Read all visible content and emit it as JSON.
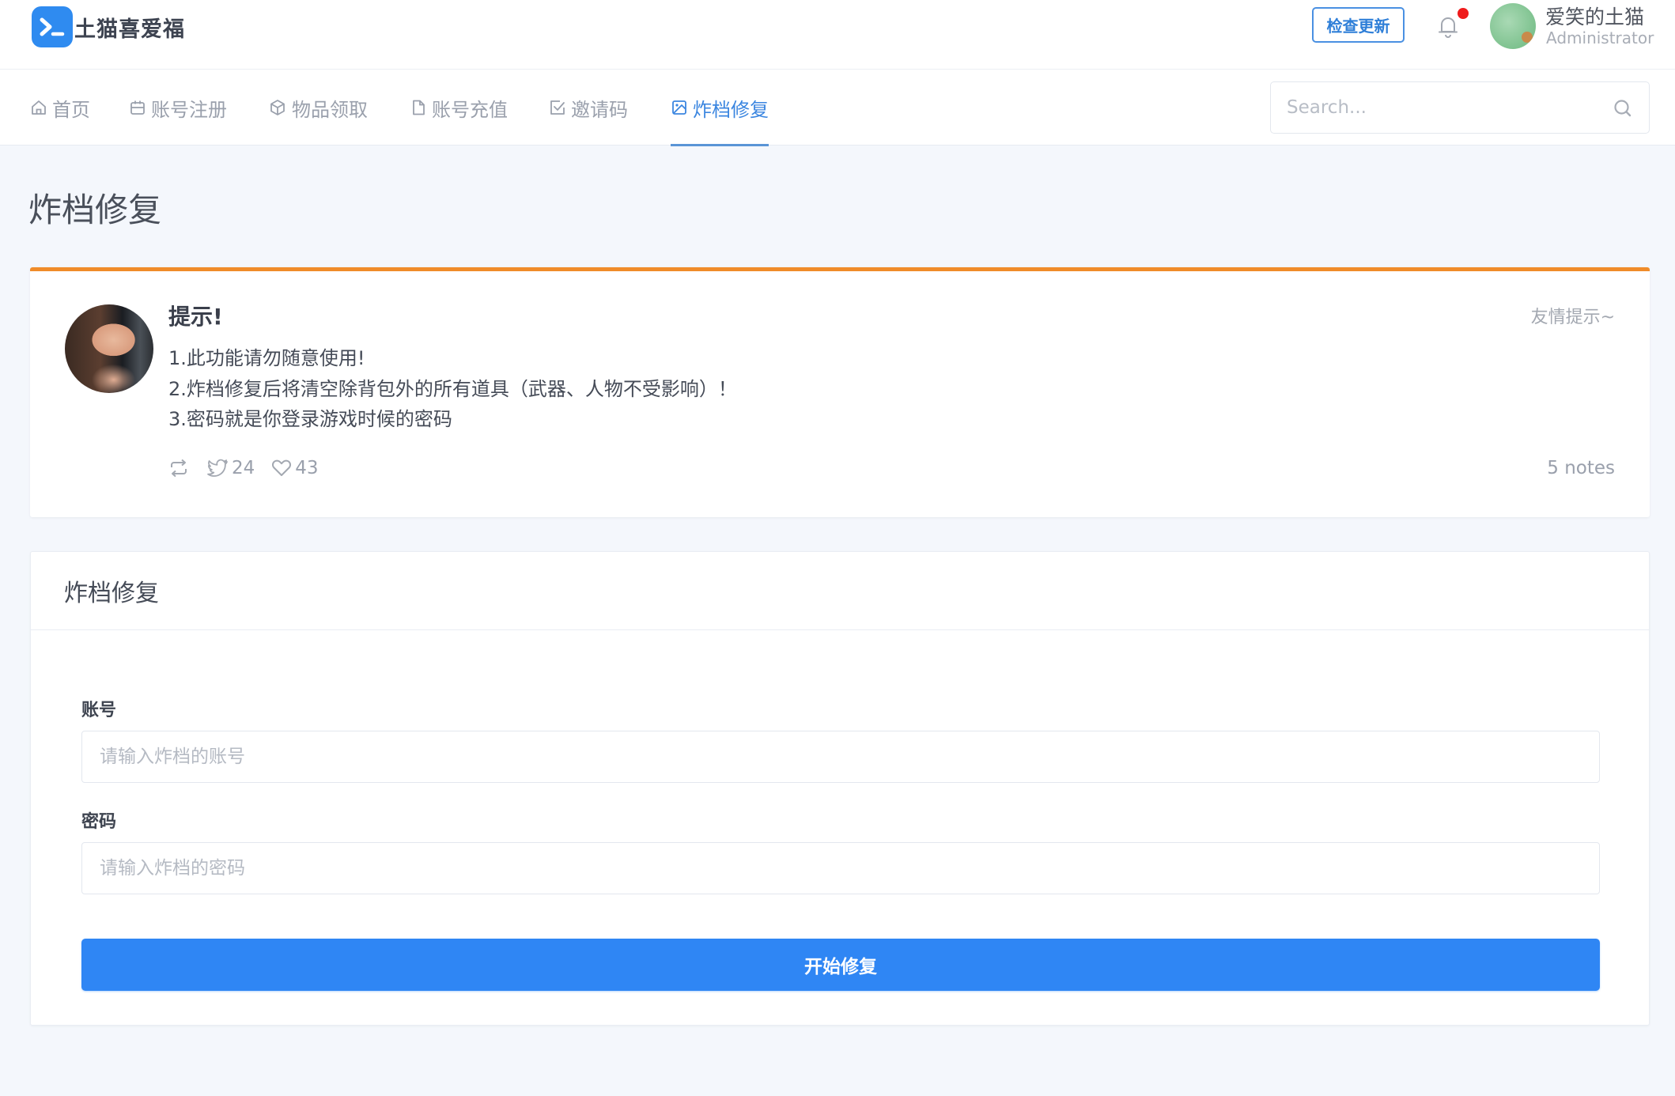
{
  "header": {
    "app_name": "土猫喜爱福",
    "update_button": "检查更新",
    "notification_badge": true,
    "user": {
      "name": "爱笑的土猫",
      "role": "Administrator"
    }
  },
  "nav": {
    "items": [
      {
        "label": "首页",
        "icon": "home-icon",
        "active": false
      },
      {
        "label": "账号注册",
        "icon": "calendar-icon",
        "active": false
      },
      {
        "label": "物品领取",
        "icon": "box-icon",
        "active": false
      },
      {
        "label": "账号充值",
        "icon": "file-icon",
        "active": false
      },
      {
        "label": "邀请码",
        "icon": "check-square-icon",
        "active": false
      },
      {
        "label": "炸档修复",
        "icon": "image-icon",
        "active": true
      }
    ],
    "search_placeholder": "Search..."
  },
  "page": {
    "title": "炸档修复"
  },
  "notice": {
    "title": "提示!",
    "tag": "友情提示~",
    "lines": [
      "1.此功能请勿随意使用!",
      "2.炸档修复后将清空除背包外的所有道具（武器、人物不受影响）！",
      "3.密码就是你登录游戏时候的密码"
    ],
    "retweet_count": "",
    "twitter_count": "24",
    "like_count": "43",
    "notes": "5 notes"
  },
  "form": {
    "title": "炸档修复",
    "account_label": "账号",
    "account_placeholder": "请输入炸档的账号",
    "account_value": "",
    "password_label": "密码",
    "password_placeholder": "请输入炸档的密码",
    "password_value": "",
    "submit_label": "开始修复"
  },
  "colors": {
    "accent": "#2f86f4",
    "notice_border": "#f08c2a",
    "badge": "#ef1b1b",
    "background": "#f4f7fc"
  }
}
